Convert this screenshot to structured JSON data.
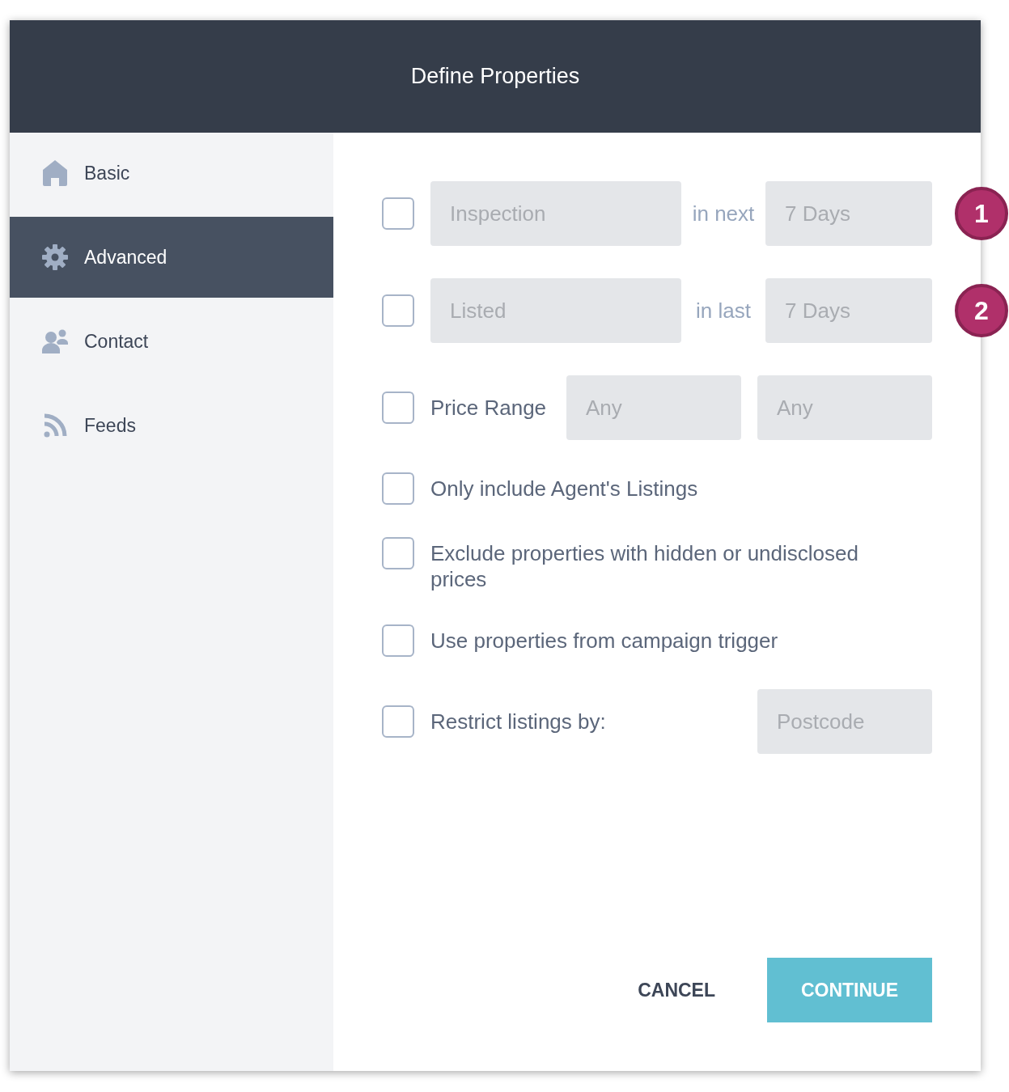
{
  "window": {
    "title": "Define Properties"
  },
  "sidebar": {
    "items": [
      {
        "label": "Basic",
        "selected": false
      },
      {
        "label": "Advanced",
        "selected": true
      },
      {
        "label": "Contact",
        "selected": false
      },
      {
        "label": "Feeds",
        "selected": false
      }
    ]
  },
  "rows": [
    {
      "kind": "range",
      "checked": false,
      "field": "Inspection",
      "connector": "in next",
      "period": "7 Days",
      "callout": "1"
    },
    {
      "kind": "range",
      "checked": false,
      "field": "Listed",
      "connector": "in last",
      "period": "7 Days",
      "callout": "2"
    },
    {
      "kind": "price",
      "checked": false,
      "label": "Price Range",
      "min": "Any",
      "max": "Any"
    },
    {
      "kind": "option",
      "checked": false,
      "label": "Only include Agent's Listings"
    },
    {
      "kind": "option",
      "checked": false,
      "label": "Exclude properties with hidden or undisclosed prices"
    },
    {
      "kind": "option",
      "checked": false,
      "label": "Use properties from campaign trigger"
    },
    {
      "kind": "restrict",
      "checked": false,
      "label": "Restrict listings by:",
      "field": "Postcode"
    }
  ],
  "buttons": {
    "cancel": "CANCEL",
    "continue": "CONTINUE"
  }
}
